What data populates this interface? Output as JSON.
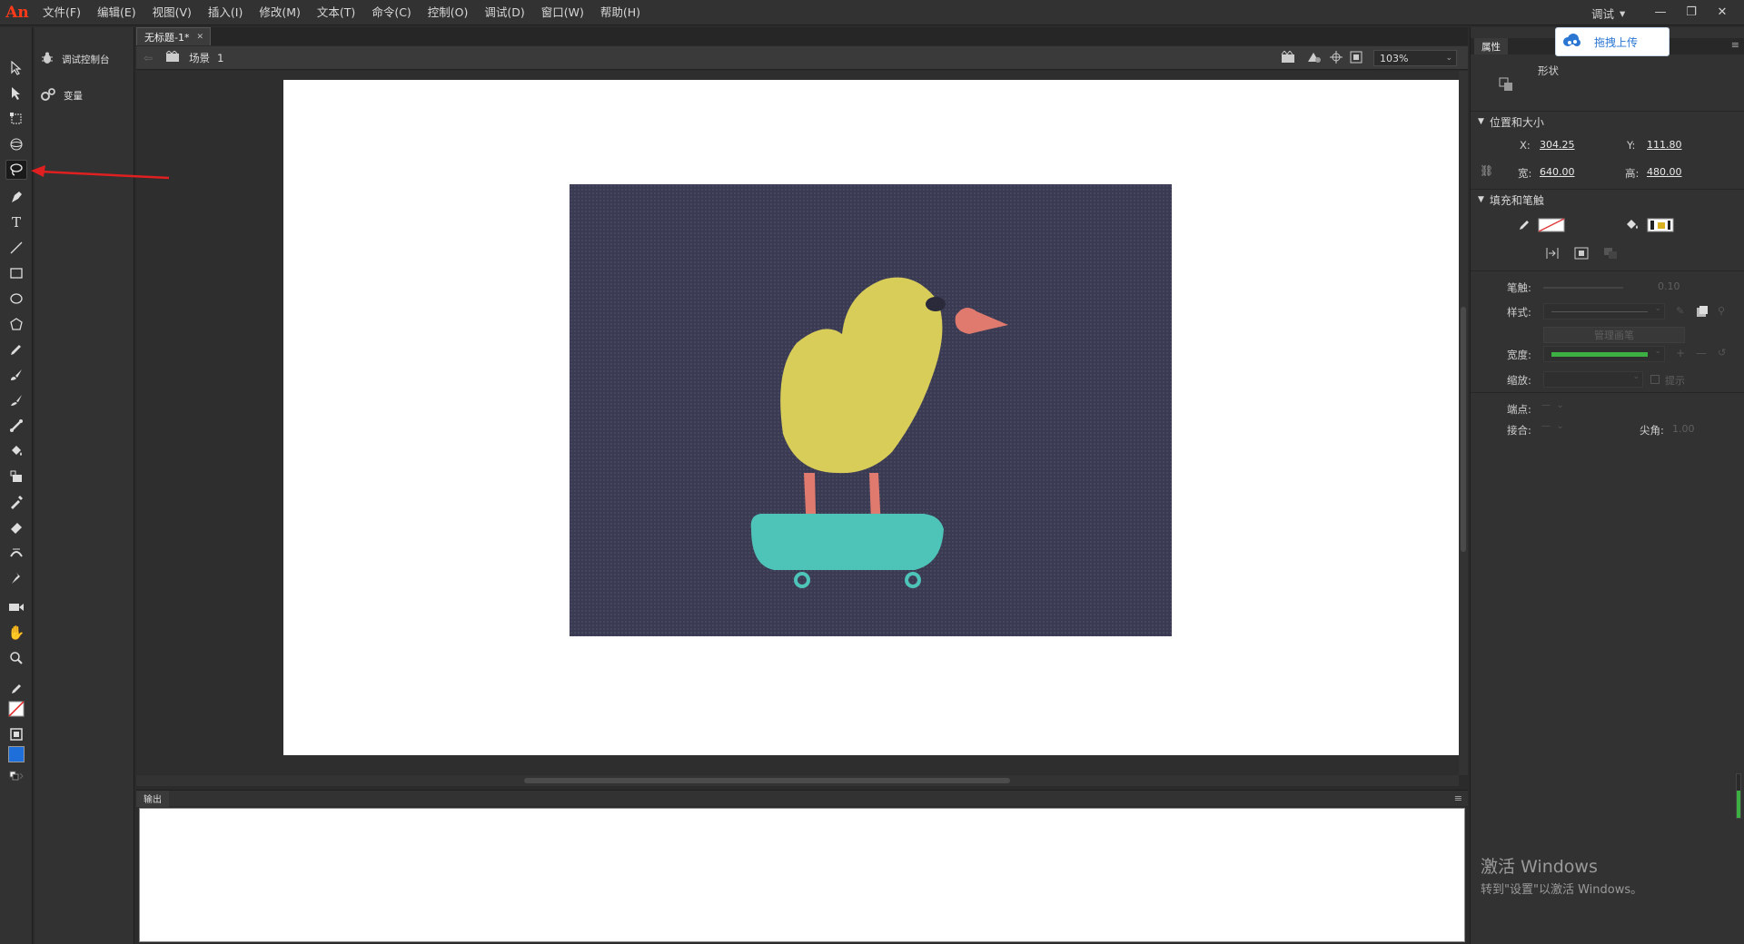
{
  "app": {
    "logo": "An"
  },
  "menu": [
    "文件(F)",
    "编辑(E)",
    "视图(V)",
    "插入(I)",
    "修改(M)",
    "文本(T)",
    "命令(C)",
    "控制(O)",
    "调试(D)",
    "窗口(W)",
    "帮助(H)"
  ],
  "workspace": {
    "label": "调试",
    "caret": "▾"
  },
  "window_controls": {
    "minimize": "—",
    "restore": "❐",
    "close": "✕"
  },
  "side_panel": {
    "items": [
      {
        "label": "调试控制台",
        "icon": "bug-icon"
      },
      {
        "label": "变量",
        "icon": "gears-icon"
      }
    ]
  },
  "document": {
    "tab_title": "无标题-1*",
    "tab_close": "✕",
    "scene_label": "场景",
    "scene_number": "1",
    "zoom": "103%"
  },
  "output": {
    "tab": "输出"
  },
  "properties": {
    "tab": "属性",
    "object_type": "形状",
    "section_position": "位置和大小",
    "x_label": "X:",
    "x_value": "304.25",
    "y_label": "Y:",
    "y_value": "111.80",
    "w_label": "宽:",
    "w_value": "640.00",
    "h_label": "高:",
    "h_value": "480.00",
    "section_fill": "填充和笔触",
    "stroke_label": "笔触:",
    "stroke_value": "0.10",
    "style_label": "样式:",
    "manage_brush": "管理画笔",
    "width_label": "宽度:",
    "scale_label": "缩放:",
    "hint_label": "提示",
    "cap_label": "端点:",
    "join_label": "接合:",
    "miter_label": "尖角:",
    "miter_value": "1.00",
    "fill_color": "#ffffff",
    "stroke_color": "#e04040"
  },
  "upload_button": {
    "label": "拖拽上传"
  },
  "watermark": {
    "title": "激活 Windows",
    "subtitle": "转到\"设置\"以激活 Windows。"
  },
  "colors": {
    "accent_red": "#e02020",
    "stroke_green": "#3cb043",
    "fill_blue": "#1e6fd9",
    "artwork_bg": "#3a3a52",
    "chick_yellow": "#d9cd5a",
    "chick_beak": "#e07a6e",
    "skateboard": "#4ec3b8"
  }
}
